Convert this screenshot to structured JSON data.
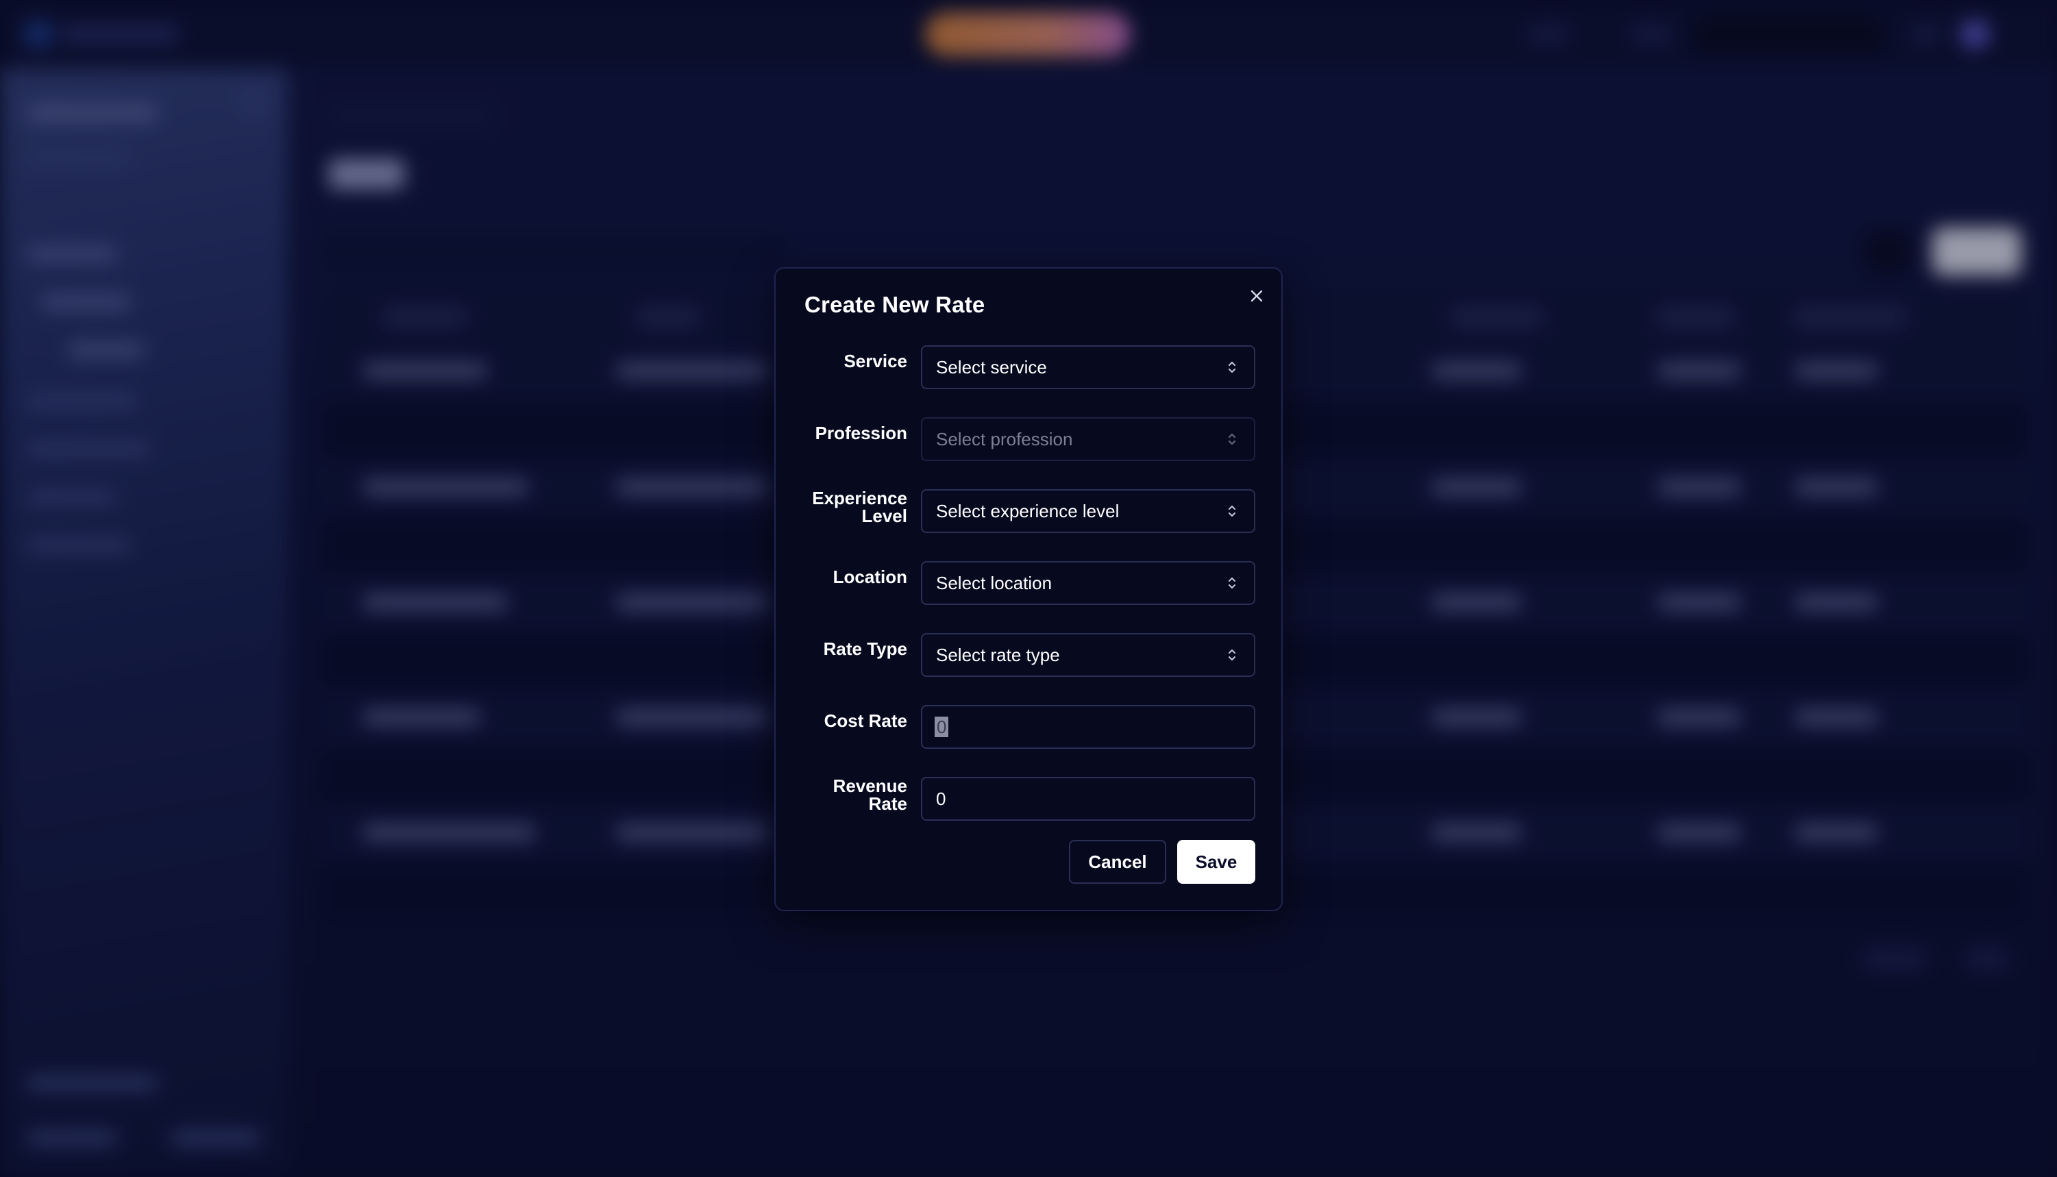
{
  "modal": {
    "title": "Create New Rate",
    "fields": {
      "service": {
        "label": "Service",
        "placeholder": "Select service"
      },
      "profession": {
        "label": "Profession",
        "placeholder": "Select profession"
      },
      "experience": {
        "label_line1": "Experience",
        "label_line2": "Level",
        "placeholder": "Select experience level"
      },
      "location": {
        "label": "Location",
        "placeholder": "Select location"
      },
      "rate_type": {
        "label": "Rate Type",
        "placeholder": "Select rate type"
      },
      "cost_rate": {
        "label": "Cost Rate",
        "value": "0"
      },
      "revenue_rate": {
        "label_line1": "Revenue",
        "label_line2": "Rate",
        "value": "0"
      }
    },
    "buttons": {
      "cancel": "Cancel",
      "save": "Save"
    }
  },
  "icons": {
    "close": "close-icon",
    "select_chevron": "chevron-up-down-icon"
  },
  "colors": {
    "modal_bg": "#07091f",
    "field_border": "#2a2f55",
    "save_bg": "#ffffff",
    "promo_gradient_start": "#d9843a",
    "promo_gradient_end": "#c670c8"
  }
}
